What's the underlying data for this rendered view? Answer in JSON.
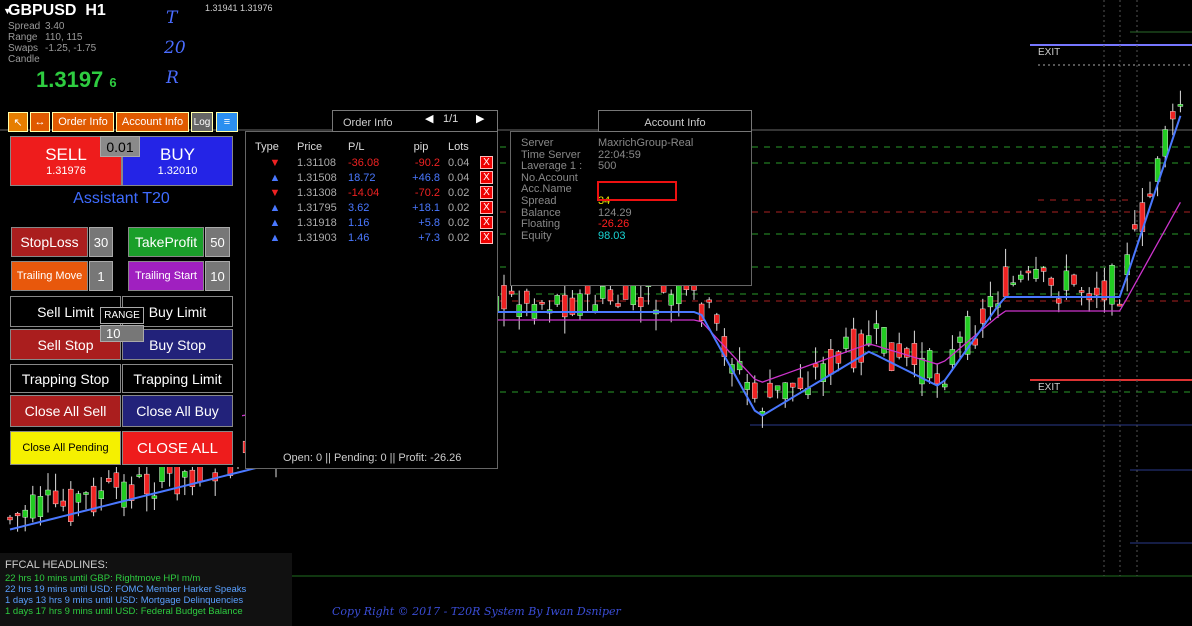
{
  "symbol": {
    "name": "GBPUSD",
    "timeframe": "H1",
    "rows": [
      {
        "k": "Spread",
        "v": "3.40"
      },
      {
        "k": "Range",
        "v": "110, 115"
      },
      {
        "k": "Swaps",
        "v": "-1.25, -1.75"
      },
      {
        "k": "Candle",
        "v": ""
      }
    ],
    "price_main": "1.3197",
    "price_digit": "6",
    "side": [
      "T",
      "20",
      "R"
    ]
  },
  "top_quote": "1.31941 1.31976",
  "exit_labels": [
    "EXIT",
    "EXIT"
  ],
  "toolbar": {
    "up_icon": "↖",
    "expand_icon": "↔",
    "order_info": "Order Info",
    "account_info": "Account Info",
    "log": "Log",
    "menu_icon": "≡"
  },
  "panel": {
    "lot": "0.01",
    "sell": "SELL",
    "sell_price": "1.31976",
    "buy": "BUY",
    "buy_price": "1.32010",
    "assistant": "Assistant T20",
    "stoploss": "StopLoss",
    "stoploss_val": "30",
    "takeprofit": "TakeProfit",
    "takeprofit_val": "50",
    "trailing_move": "Trailing Move",
    "trailing_move_val": "1",
    "trailing_start": "Trailing Start",
    "trailing_start_val": "10",
    "sell_limit": "Sell Limit",
    "buy_limit": "Buy Limit",
    "range": "RANGE",
    "range_val": "10",
    "sell_stop": "Sell Stop",
    "buy_stop": "Buy Stop",
    "trapping_stop": "Trapping Stop",
    "trapping_limit": "Trapping Limit",
    "close_all_sell": "Close All Sell",
    "close_all_buy": "Close All Buy",
    "close_all_pending": "Close All Pending",
    "close_all": "CLOSE ALL"
  },
  "order_info": {
    "title": "Order Info",
    "page": "1/1",
    "headers": [
      "Type",
      "Price",
      "P/L",
      "pip",
      "Lots"
    ],
    "rows": [
      {
        "type": "sell",
        "price": "1.31108",
        "pl": "-36.08",
        "pip": "-90.2",
        "lots": "0.04"
      },
      {
        "type": "buy",
        "price": "1.31508",
        "pl": "18.72",
        "pip": "+46.8",
        "lots": "0.04"
      },
      {
        "type": "sell",
        "price": "1.31308",
        "pl": "-14.04",
        "pip": "-70.2",
        "lots": "0.02"
      },
      {
        "type": "buy",
        "price": "1.31795",
        "pl": "3.62",
        "pip": "+18.1",
        "lots": "0.02"
      },
      {
        "type": "buy",
        "price": "1.31918",
        "pl": "1.16",
        "pip": "+5.8",
        "lots": "0.02"
      },
      {
        "type": "buy",
        "price": "1.31903",
        "pl": "1.46",
        "pip": "+7.3",
        "lots": "0.02"
      }
    ],
    "close_icon": "X",
    "footer": "Open: 0 || Pending: 0 || Profit: -26.26"
  },
  "account_info": {
    "title": "Account Info",
    "rows": [
      {
        "k": "Server",
        "v": "MaxrichGroup-Real",
        "c": "#888"
      },
      {
        "k": "Time Server",
        "v": "22:04:59",
        "c": "#888"
      },
      {
        "k": "Laverage  1 :",
        "v": "500",
        "c": "#888"
      },
      {
        "k": "No.Account",
        "v": "",
        "c": "#888"
      },
      {
        "k": "Acc.Name",
        "v": "",
        "c": "#888"
      },
      {
        "k": "Spread",
        "v": "34",
        "c": "#e6e600"
      },
      {
        "k": "Balance",
        "v": "124.29",
        "c": "#888"
      },
      {
        "k": "Floating",
        "v": "-26.26",
        "c": "#ff2020"
      },
      {
        "k": "Equity",
        "v": "98.03",
        "c": "#19d3d3"
      }
    ]
  },
  "headlines": {
    "title": "FFCAL HEADLINES:",
    "items": [
      {
        "text": "22 hrs 10 mins until GBP: Rightmove HPI m/m",
        "c": "#2ecc40"
      },
      {
        "text": "22 hrs 19 mins until USD: FOMC Member Harker Speaks",
        "c": "#5aa0ff"
      },
      {
        "text": "1 days 13 hrs 9 mins until USD: Mortgage Delinquencies",
        "c": "#5aa0ff"
      },
      {
        "text": "1 days 17 hrs 9 mins until USD: Federal Budget Balance",
        "c": "#2ecc40"
      }
    ]
  },
  "copyright": "Copy Right © 2017 - T20R System By Iwan Dsniper",
  "colors": {
    "bull": "#22cc22",
    "bear": "#ee2222",
    "ma_fast": "#4a78ff",
    "ma_slow": "#cc33cc"
  }
}
